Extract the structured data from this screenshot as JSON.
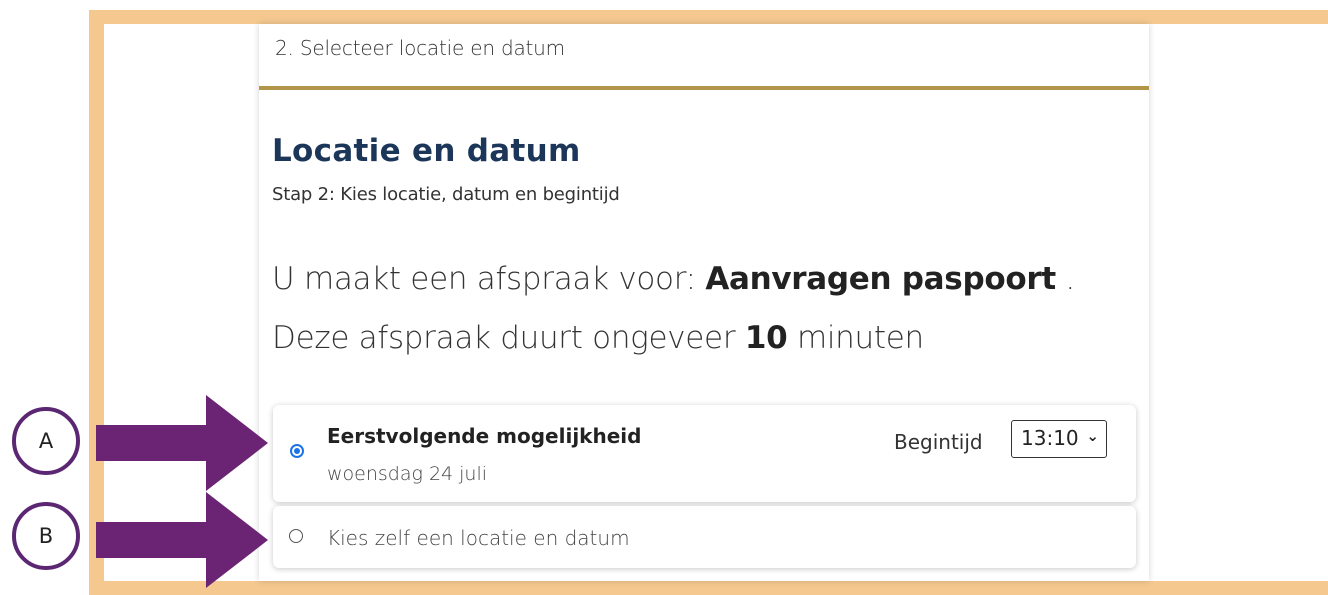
{
  "header": {
    "step_label": "2. Selecteer locatie en datum"
  },
  "main": {
    "title": "Locatie en datum",
    "subtitle": "Stap 2: Kies locatie, datum en begintijd",
    "intro": {
      "prefix": "U maakt een afspraak voor: ",
      "service": "Aanvragen paspoort",
      "middle": " . Deze afspraak duurt ongeveer ",
      "duration": "10",
      "suffix": " minuten"
    },
    "options": [
      {
        "title": "Eerstvolgende mogelijkheid",
        "date": "woensdag 24 juli",
        "selected": true,
        "time_label": "Begintijd",
        "time_value": "13:10"
      },
      {
        "title": "Kies zelf een locatie en datum",
        "selected": false
      }
    ]
  },
  "annotations": {
    "marker_a": "A",
    "marker_b": "B",
    "arrow_color": "#6b2474",
    "frame_color": "#f5c890"
  },
  "colors": {
    "title": "#1b3658",
    "accent_rule": "#b39549",
    "radio": "#1a73e8"
  }
}
